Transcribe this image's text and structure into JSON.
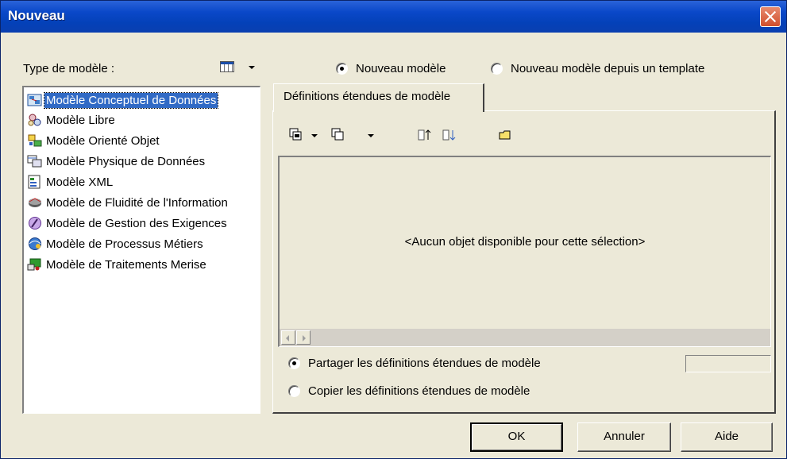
{
  "window": {
    "title": "Nouveau"
  },
  "left": {
    "type_label": "Type de modèle :",
    "items": [
      {
        "label": "Modèle Conceptuel de Données",
        "icon": "mcd-icon",
        "selected": true
      },
      {
        "label": "Modèle Libre",
        "icon": "free-model-icon"
      },
      {
        "label": "Modèle Orienté Objet",
        "icon": "oom-icon"
      },
      {
        "label": "Modèle Physique de Données",
        "icon": "pdm-icon"
      },
      {
        "label": "Modèle XML",
        "icon": "xml-model-icon"
      },
      {
        "label": "Modèle de Fluidité de l'Information",
        "icon": "ilm-icon"
      },
      {
        "label": "Modèle de Gestion des Exigences",
        "icon": "rqm-icon"
      },
      {
        "label": "Modèle de Processus Métiers",
        "icon": "bpm-icon"
      },
      {
        "label": "Modèle de Traitements Merise",
        "icon": "merise-icon"
      }
    ]
  },
  "mode": {
    "options": [
      {
        "label": "Nouveau modèle",
        "checked": true
      },
      {
        "label": "Nouveau modèle depuis un template",
        "checked": false
      }
    ]
  },
  "tab": {
    "label": "Définitions étendues de modèle"
  },
  "panel": {
    "empty_text": "<Aucun objet disponible pour cette sélection>"
  },
  "share": {
    "options": [
      {
        "label": "Partager les définitions étendues de modèle",
        "checked": true
      },
      {
        "label": "Copier les définitions étendues de modèle",
        "checked": false
      }
    ]
  },
  "buttons": {
    "ok": "OK",
    "cancel": "Annuler",
    "help": "Aide"
  },
  "colors": {
    "title_bar": "#0a48c9",
    "selection": "#316ac5",
    "dialog_bg": "#ece9d8"
  }
}
